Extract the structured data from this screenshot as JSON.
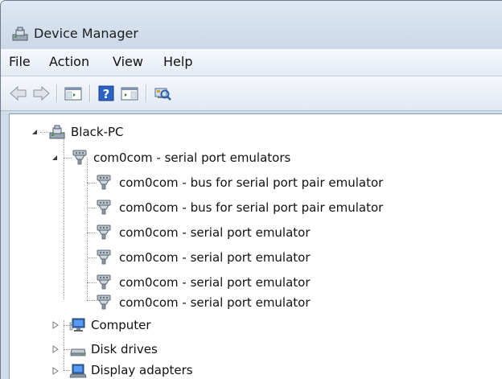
{
  "window": {
    "title": "Device Manager",
    "icon": "device-manager-icon"
  },
  "menu": [
    "File",
    "Action",
    "View",
    "Help"
  ],
  "toolbar": {
    "buttons": [
      "back-arrow-icon",
      "forward-arrow-icon",
      "show-hide-console-tree-icon",
      "help-icon",
      "properties-pane-icon",
      "scan-hardware-changes-icon"
    ]
  },
  "tree": {
    "root": {
      "label": "Black-PC",
      "expanded": true,
      "icon": "computer-root-icon"
    },
    "category": {
      "label": "com0com - serial port emulators",
      "expanded": true,
      "icon": "serial-port-icon"
    },
    "children": [
      "com0com - bus for serial port pair emulator",
      "com0com - bus for serial port pair emulator",
      "com0com - serial port emulator",
      "com0com - serial port emulator",
      "com0com - serial port emulator",
      "com0com - serial port emulator"
    ],
    "collapsed_categories": [
      {
        "label": "Computer",
        "icon": "computer-icon"
      },
      {
        "label": "Disk drives",
        "icon": "disk-drive-icon"
      },
      {
        "label": "Display adapters",
        "icon": "display-adapter-icon"
      }
    ]
  },
  "colors": {
    "titlebar": "#cad8e8",
    "text": "#111111",
    "tree_lines": "#9a9a9a"
  }
}
